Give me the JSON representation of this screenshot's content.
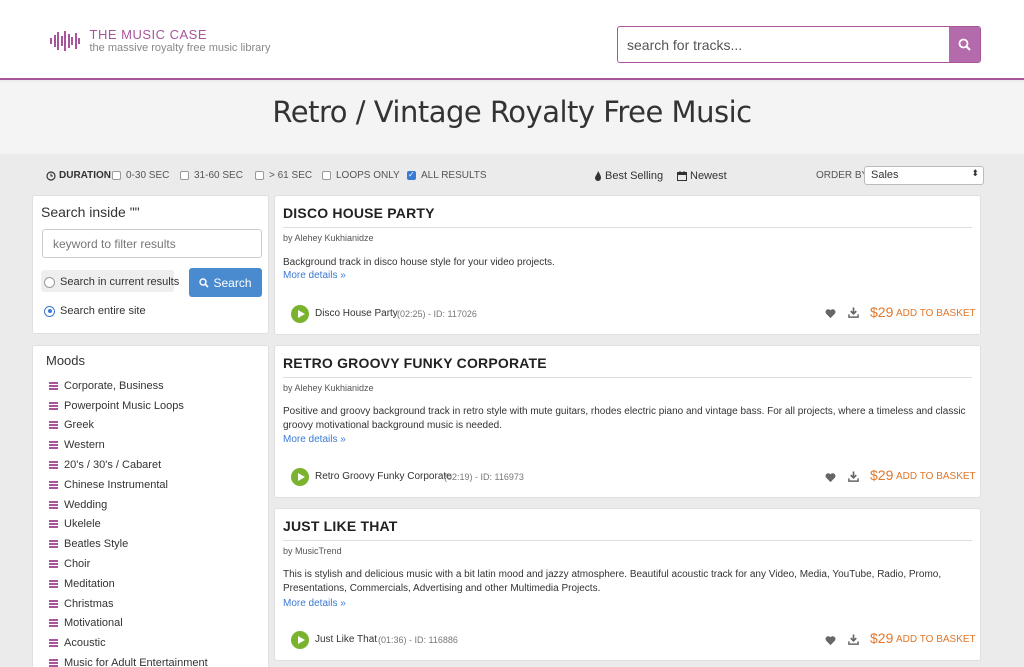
{
  "header": {
    "logo_title": "THE MUSIC CASE",
    "logo_subtitle": "the massive royalty free music library",
    "search_placeholder": "search for tracks...",
    "brand_color": "#a8569b"
  },
  "hero": {
    "title": "Retro / Vintage Royalty Free Music"
  },
  "filters": {
    "duration_label": "DURATION:",
    "options": [
      {
        "label": "0-30 SEC",
        "checked": false
      },
      {
        "label": "31-60 SEC",
        "checked": false
      },
      {
        "label": "> 61 SEC",
        "checked": false
      },
      {
        "label": "LOOPS ONLY",
        "checked": false
      },
      {
        "label": "ALL RESULTS",
        "checked": true
      }
    ],
    "best_selling": "Best Selling",
    "newest": "Newest",
    "order_by_label": "ORDER BY:",
    "order_by_value": "Sales"
  },
  "search_inside": {
    "title": "Search inside \"\"",
    "placeholder": "keyword to filter results",
    "current_label": "Search in current results",
    "entire_label": "Search entire site",
    "button_label": "Search"
  },
  "moods": {
    "title": "Moods",
    "items": [
      "Corporate, Business",
      "Powerpoint Music Loops",
      "Greek",
      "Western",
      "20's / 30's / Cabaret",
      "Chinese Instrumental",
      "Wedding",
      "Ukelele",
      "Beatles Style",
      "Choir",
      "Meditation",
      "Christmas",
      "Motivational",
      "Acoustic",
      "Music for Adult Entertainment"
    ]
  },
  "tracks": [
    {
      "title": "DISCO HOUSE PARTY",
      "author": "by Alehey Kukhianidze",
      "desc_lines": [
        "Background track in disco house style for your video projects."
      ],
      "more": "More details »",
      "name": "Disco House Party",
      "meta": "(02:25) - ID: 117026",
      "price": "$29",
      "basket": "ADD TO BASKET"
    },
    {
      "title": "RETRO GROOVY FUNKY CORPORATE",
      "author": "by Alehey Kukhianidze",
      "desc_lines": [
        "Positive and groovy background track in retro style with mute guitars, rhodes electric piano and vintage bass. For all projects, where a timeless and classic",
        "groovy motivational background music is needed."
      ],
      "more": "More details »",
      "name": "Retro Groovy Funky Corporate",
      "meta": "(02:19) - ID: 116973",
      "price": "$29",
      "basket": "ADD TO BASKET"
    },
    {
      "title": "JUST LIKE THAT",
      "author": "by MusicTrend",
      "desc_lines": [
        "This is stylish and delicious music with a bit latin mood and jazzy atmosphere. Beautiful acoustic track for any Video, Media, YouTube, Radio, Promo,",
        "Presentations, Commercials, Advertising and other Multimedia Projects."
      ],
      "more": "More details »",
      "name": "Just Like That",
      "meta": "(01:36) - ID: 116886",
      "price": "$29",
      "basket": "ADD TO BASKET"
    }
  ]
}
